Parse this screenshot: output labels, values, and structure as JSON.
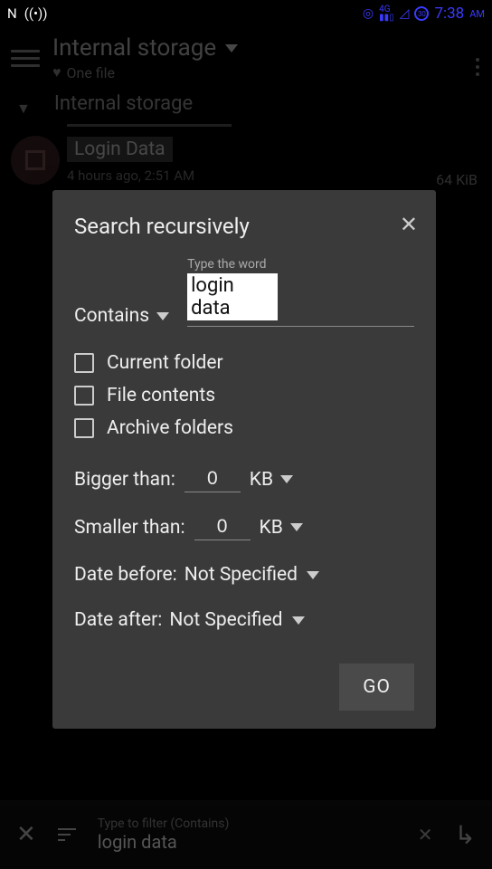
{
  "statusbar": {
    "left": "N",
    "time": "7:38",
    "ampm": "AM"
  },
  "header": {
    "title": "Internal storage",
    "subtitle": "One file"
  },
  "breadcrumb": {
    "path": "Internal storage"
  },
  "file": {
    "name": "Login Data",
    "meta": "4 hours ago, 2:51 AM",
    "size": "64 KiB"
  },
  "dialog": {
    "title": "Search recursively",
    "mode_label": "Contains",
    "input_hint": "Type the word",
    "input_value": "login data",
    "checks": {
      "current_folder": "Current folder",
      "file_contents": "File contents",
      "archive_folders": "Archive folders"
    },
    "bigger_label": "Bigger than:",
    "bigger_value": "0",
    "bigger_unit": "KB",
    "smaller_label": "Smaller than:",
    "smaller_value": "0",
    "smaller_unit": "KB",
    "date_before_label": "Date before:",
    "date_before_value": "Not Specified",
    "date_after_label": "Date after:",
    "date_after_value": "Not Specified",
    "go": "GO"
  },
  "bottombar": {
    "hint": "Type to filter (Contains)",
    "value": "login data"
  }
}
